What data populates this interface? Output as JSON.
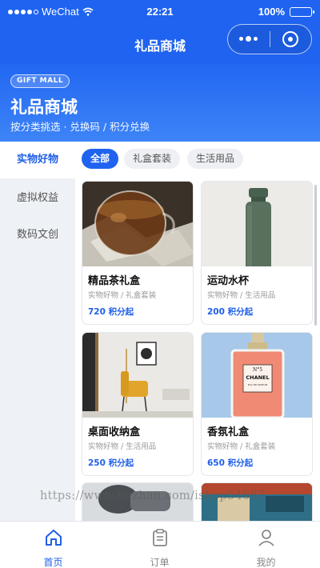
{
  "status_bar": {
    "carrier": "WeChat",
    "time": "22:21",
    "battery_text": "100%",
    "battery_level": 1.0,
    "icons": [
      "signal-dots-icon",
      "wifi-icon",
      "battery-icon"
    ]
  },
  "nav": {
    "title": "礼品商城",
    "capsule_icons": [
      "more-dots-icon",
      "close-miniprogram-icon"
    ]
  },
  "hero": {
    "badge": "GIFT MALL",
    "title": "礼品商城",
    "subtitle": "按分类挑选 · 兑换码 / 积分兑换"
  },
  "sidebar": {
    "items": [
      {
        "label": "实物好物",
        "active": true
      },
      {
        "label": "虚拟权益",
        "active": false
      },
      {
        "label": "数码文创",
        "active": false
      }
    ]
  },
  "filters": {
    "chips": [
      {
        "label": "全部",
        "active": true
      },
      {
        "label": "礼盒套装",
        "active": false
      },
      {
        "label": "生活用品",
        "active": false
      }
    ]
  },
  "products": [
    {
      "name": "精品茶礼盒",
      "tags": "实物好物 / 礼盒套装",
      "price": "720 积分起"
    },
    {
      "name": "运动水杯",
      "tags": "实物好物 / 生活用品",
      "price": "200 积分起"
    },
    {
      "name": "桌面收纳盒",
      "tags": "实物好物 / 生活用品",
      "price": "250 积分起"
    },
    {
      "name": "香氛礼盒",
      "tags": "实物好物 / 礼盒套装",
      "price": "650 积分起"
    }
  ],
  "product_images": {
    "perfume_label_brand": "CHANEL",
    "perfume_label_number": "N°5",
    "perfume_label_small": "EAU DE PARFUM"
  },
  "watermark": "https://www.huzhan.com/ishop54687",
  "tab_bar": {
    "items": [
      {
        "label": "首页",
        "icon": "home-icon",
        "active": true
      },
      {
        "label": "订单",
        "icon": "clipboard-icon",
        "active": false
      },
      {
        "label": "我的",
        "icon": "user-icon",
        "active": false
      }
    ]
  },
  "colors": {
    "primary": "#1f63f0",
    "accent_text": "#1f5fe8",
    "sidebar_bg": "#eef1f5"
  }
}
